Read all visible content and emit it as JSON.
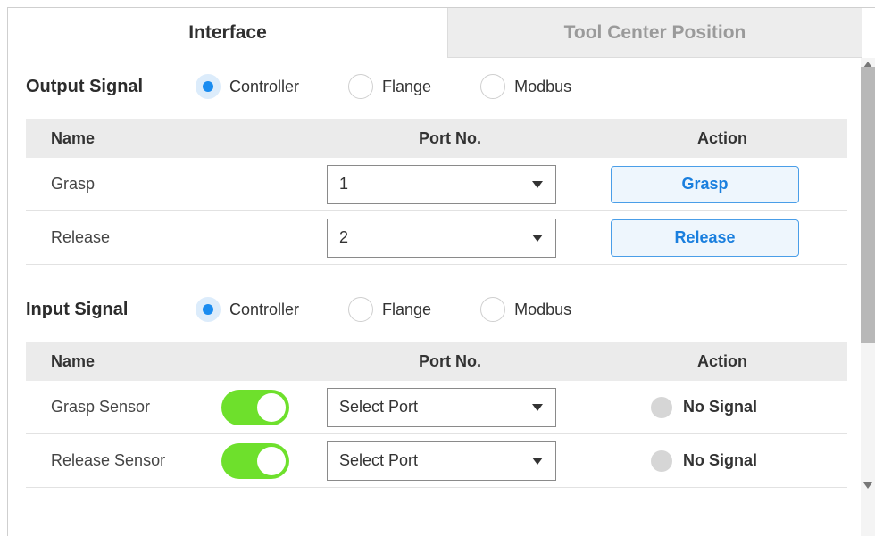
{
  "tabs": [
    {
      "label": "Interface",
      "active": true
    },
    {
      "label": "Tool Center Position",
      "active": false
    }
  ],
  "output_signal": {
    "title": "Output Signal",
    "options": [
      "Controller",
      "Flange",
      "Modbus"
    ],
    "selected": "Controller",
    "columns": [
      "Name",
      "Port No.",
      "Action"
    ],
    "rows": [
      {
        "name": "Grasp",
        "port": "1",
        "action": "Grasp"
      },
      {
        "name": "Release",
        "port": "2",
        "action": "Release"
      }
    ]
  },
  "input_signal": {
    "title": "Input Signal",
    "options": [
      "Controller",
      "Flange",
      "Modbus"
    ],
    "selected": "Controller",
    "columns": [
      "Name",
      "Port No.",
      "Action"
    ],
    "rows": [
      {
        "name": "Grasp Sensor",
        "enabled": true,
        "port": "Select Port",
        "status": "No Signal"
      },
      {
        "name": "Release Sensor",
        "enabled": true,
        "port": "Select Port",
        "status": "No Signal"
      }
    ]
  },
  "colors": {
    "accent": "#1a8cf0",
    "toggle_on": "#6ee02c",
    "header_bg": "#ebebeb",
    "signal_off": "#d6d6d6"
  }
}
